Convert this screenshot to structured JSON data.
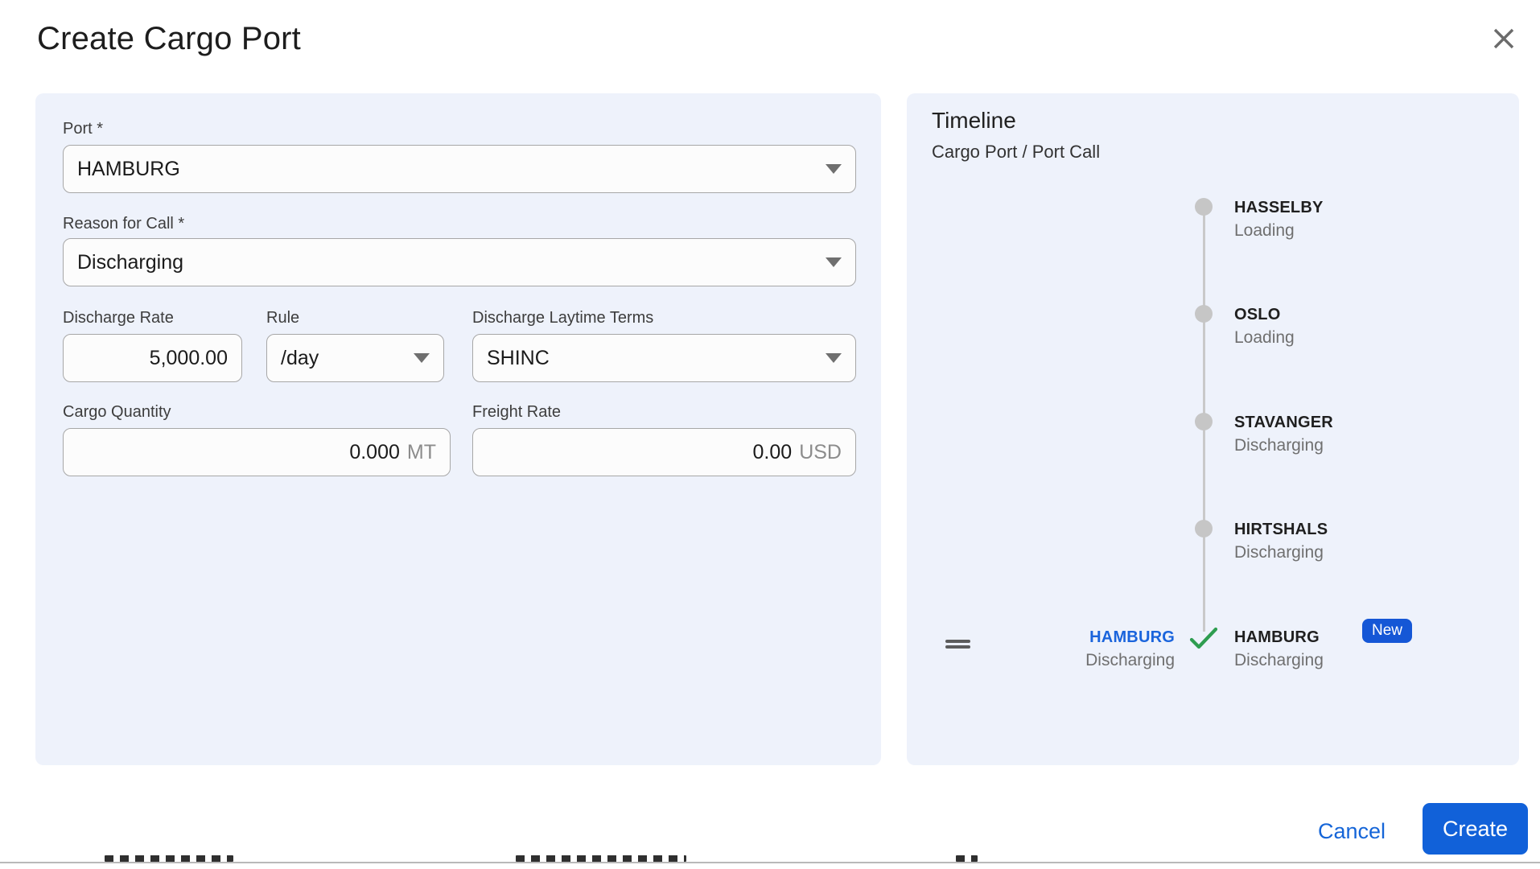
{
  "dialog": {
    "title": "Create Cargo Port"
  },
  "form": {
    "port": {
      "label": "Port *",
      "value": "HAMBURG"
    },
    "reason_for_call": {
      "label": "Reason for Call *",
      "value": "Discharging"
    },
    "discharge_rate": {
      "label": "Discharge Rate",
      "value": "5,000.00"
    },
    "rule": {
      "label": "Rule",
      "value": "/day"
    },
    "discharge_laytime_terms": {
      "label": "Discharge Laytime Terms",
      "value": "SHINC"
    },
    "cargo_quantity": {
      "label": "Cargo Quantity",
      "value": "0.000",
      "unit": "MT"
    },
    "freight_rate": {
      "label": "Freight Rate",
      "value": "0.00",
      "unit": "USD"
    }
  },
  "timeline": {
    "heading": "Timeline",
    "subheading": "Cargo Port / Port Call",
    "entries": [
      {
        "port": "HASSELBY",
        "reason": "Loading"
      },
      {
        "port": "OSLO",
        "reason": "Loading"
      },
      {
        "port": "STAVANGER",
        "reason": "Discharging"
      },
      {
        "port": "HIRTSHALS",
        "reason": "Discharging"
      }
    ],
    "new_entry": {
      "preview_port": "HAMBURG",
      "preview_reason": "Discharging",
      "port": "HAMBURG",
      "reason": "Discharging",
      "badge": "New"
    }
  },
  "footer": {
    "cancel_label": "Cancel",
    "create_label": "Create"
  },
  "colors": {
    "panel_bg": "#eef2fb",
    "accent_blue": "#1161d9",
    "link_blue": "#1565d8",
    "badge_blue": "#1557d6",
    "highlight_blue": "#1a64dc",
    "success_green": "#2e9d50",
    "dot_gray": "#c6c6c6"
  }
}
